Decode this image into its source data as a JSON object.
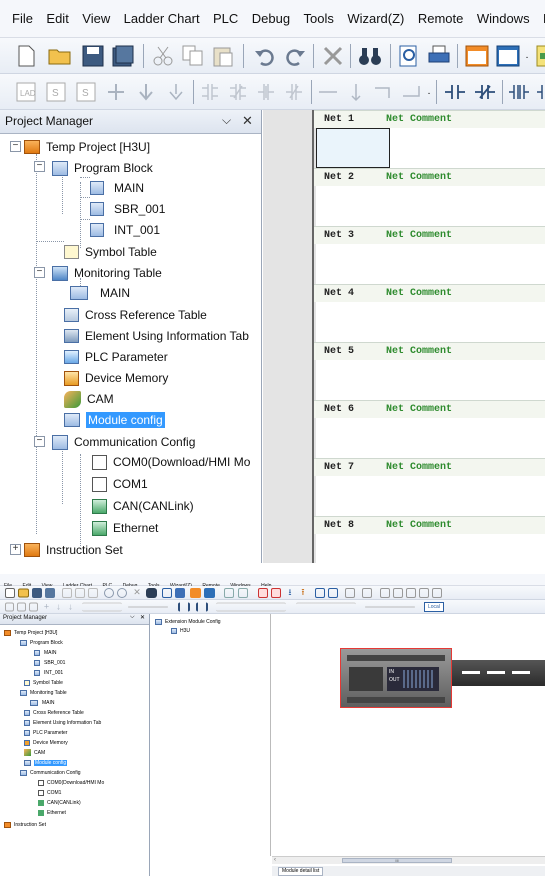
{
  "menu": [
    "File",
    "Edit",
    "View",
    "Ladder Chart",
    "PLC",
    "Debug",
    "Tools",
    "Wizard(Z)",
    "Remote",
    "Windows",
    "Help"
  ],
  "panel": {
    "title": "Project Manager",
    "pin_glyph": "⌵",
    "close_glyph": "✕"
  },
  "tree": {
    "project": "Temp Project [H3U]",
    "program_block": "Program Block",
    "main": "MAIN",
    "sbr": "SBR_001",
    "intr": "INT_001",
    "symbol_table": "Symbol Table",
    "monitoring_table": "Monitoring Table",
    "monitoring_main": "MAIN",
    "cross_reference": "Cross Reference Table",
    "element_using": "Element Using Information Tab",
    "plc_parameter": "PLC Parameter",
    "device_memory": "Device Memory",
    "cam": "CAM",
    "module_config": "Module config",
    "communication_config": "Communication Config",
    "com0": "COM0(Download/HMI Mo",
    "com1": "COM1",
    "can": "CAN(CANLink)",
    "ethernet": "Ethernet",
    "instruction_set": "Instruction Set"
  },
  "nets": [
    {
      "label": "Net 1",
      "comment": "Net Comment"
    },
    {
      "label": "Net 2",
      "comment": "Net Comment"
    },
    {
      "label": "Net 3",
      "comment": "Net Comment"
    },
    {
      "label": "Net 4",
      "comment": "Net Comment"
    },
    {
      "label": "Net 5",
      "comment": "Net Comment"
    },
    {
      "label": "Net 6",
      "comment": "Net Comment"
    },
    {
      "label": "Net 7",
      "comment": "Net Comment"
    },
    {
      "label": "Net 8",
      "comment": "Net Comment"
    }
  ],
  "module_tree": {
    "root": "Extension Module Config",
    "child": "H3U"
  },
  "device_labels": {
    "line1": "IN",
    "line2": "OUT"
  },
  "bottom_tab": "Module detail list",
  "toolbar_local": "Local",
  "scroll_glyph": "III",
  "colors": {
    "selection": "#3399ff",
    "net_comment": "#2e8b2e",
    "ladder_bg": "#e4e4e4",
    "highlight_border": "#e53935"
  }
}
